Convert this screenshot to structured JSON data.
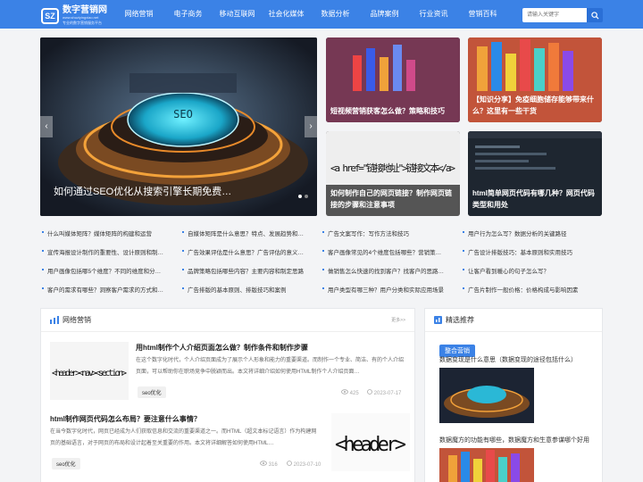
{
  "brand": {
    "mark": "SZ",
    "name": "数字营销网",
    "domain": "www.shuziyingxiao.net",
    "slogan": "专业的数字营销服务平台"
  },
  "nav": [
    "网络营销",
    "电子商务",
    "移动互联网",
    "社会化媒体",
    "数据分析",
    "品牌案例",
    "行业资讯",
    "营销百科"
  ],
  "search": {
    "placeholder": "请输入关键字"
  },
  "slider": {
    "title": "如何通过SEO优化从搜索引擎长期免费…",
    "prev": "‹",
    "next": "›",
    "slide_text": "SEO"
  },
  "cards": [
    {
      "caption": "短视频营销获客怎么做？策略和技巧"
    },
    {
      "caption": "【知识分享】免疫细胞储存能够带来什么？这里有一些干货"
    },
    {
      "caption": "如何制作自己的网页链接？制作网页链接的步骤和注意事项",
      "overlay": "<a href=\"链接地址\">链接文本</a>"
    },
    {
      "caption": "html简单网页代码有哪几种？网页代码类型和用处"
    }
  ],
  "links": [
    [
      "什么叫媒体矩阵？媒体矩阵的构建和运营",
      "自媒体矩阵是什么意思？特点、发展趋势和…",
      "广告文案写作：写作方法和技巧",
      "用户行为怎么写？数据分析的关键路径"
    ],
    [
      "宣传海报设计制作的重要性、设计原则和制…",
      "广告效果评估是什么意思？广告评估的意义…",
      "客户画像常见的4个维度包括哪些？营销策…",
      "广告设计排版技巧：基本原则和实用技巧"
    ],
    [
      "用户画像包括哪5个维度？不同的维度和分…",
      "品牌策略包括哪些内容？主要内容和制定思路",
      "做销售怎么快速的找到客户？找客户的思路…",
      "让客户看到暖心的句子怎么写？"
    ],
    [
      "客户的需求有哪些？洞察客户需求的方式和…",
      "广告排版的基本原则、排版技巧和案例",
      "用户类型有哪三种？用户分类和实际应用场景",
      "广告片制作一般价格：价格构成与影响因素"
    ]
  ],
  "main_panel": {
    "title": "网络营销",
    "more": "更多>>",
    "articles": [
      {
        "title": "用html制作个人介绍页面怎么做？制作条件和制作步骤",
        "summary": "在这个数字化时代，个人介绍页面成为了展示个人形象和能力的重要渠道。而制作一个专业、简洁、有的个人介绍页面，可以帮助你在职场竞争中脱颖而出。本文将详细介绍如何使用HTML制作个人介绍页面…",
        "tag": "seo优化",
        "views": "425",
        "date": "2023-07-17",
        "thumb": "<header><nav><section>"
      },
      {
        "title": "html制作网页代码怎么布局？要注意什么事情？",
        "summary": "在当今数字化时代，网页已经成为人们获取信息和交流的重要渠道之一。而HTML（超文本标记语言）作为构建网页的基础语言，对于网页的布局和设计起着至关重要的作用。本文将详细解答如何使用HTML…",
        "tag": "seo优化",
        "views": "316",
        "date": "2023-07-10",
        "thumb": "<header>"
      }
    ]
  },
  "side_panel": {
    "title": "精选推荐",
    "tag": "整合营销",
    "items": [
      "数据变现是什么意思（数据变现的途径包括什么）",
      "数据魔方的功能有哪些，数据魔方和生意参谋哪个好用"
    ]
  },
  "colors": {
    "primary": "#3b82e6",
    "bg": "#f3f4f6"
  }
}
